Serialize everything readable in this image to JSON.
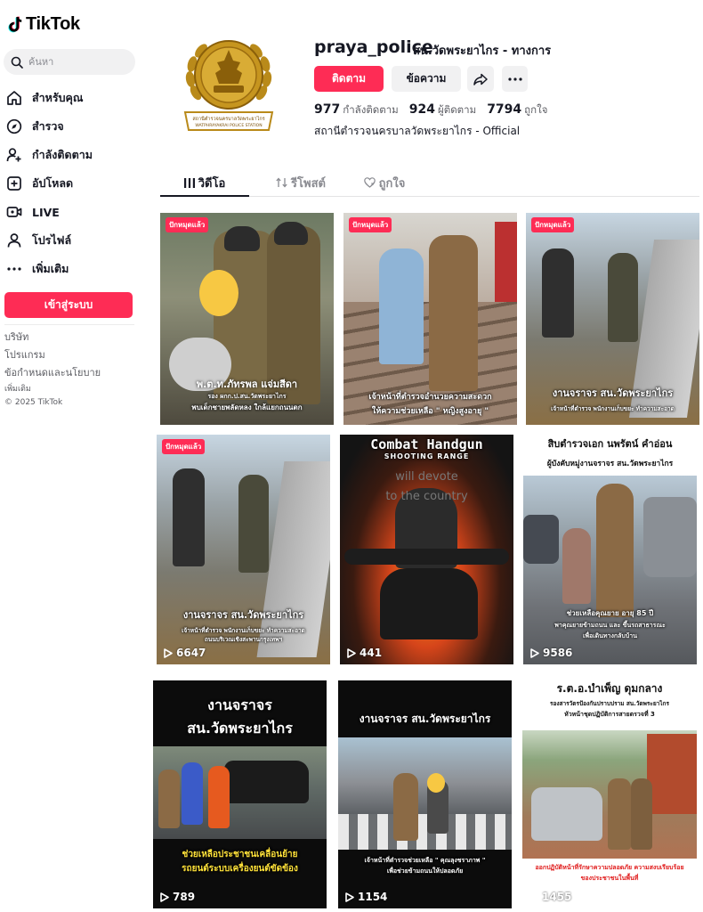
{
  "app": {
    "name": "TikTok"
  },
  "search": {
    "placeholder": "ค้นหา"
  },
  "nav": [
    {
      "label": "สำหรับคุณ",
      "icon": "home-icon"
    },
    {
      "label": "สำรวจ",
      "icon": "compass-icon"
    },
    {
      "label": "กำลังติดตาม",
      "icon": "following-icon"
    },
    {
      "label": "อัปโหลด",
      "icon": "upload-icon"
    },
    {
      "label": "LIVE",
      "icon": "live-icon"
    },
    {
      "label": "โปรไฟล์",
      "icon": "profile-icon"
    },
    {
      "label": "เพิ่มเติม",
      "icon": "more-icon"
    }
  ],
  "login": {
    "label": "เข้าสู่ระบบ"
  },
  "footer": {
    "links": [
      "บริษัท",
      "โปรแกรม",
      "ข้อกำหนดและนโยบาย"
    ],
    "more": "เพิ่มเติม",
    "copyright": "© 2025 TikTok"
  },
  "profile": {
    "username": "praya_police",
    "nickname": "สน.วัดพระยาไกร - ทางการ",
    "follow_label": "ติดตาม",
    "message_label": "ข้อความ",
    "following_count": "977",
    "following_label": "กำลังติดตาม",
    "followers_count": "924",
    "followers_label": "ผู้ติดตาม",
    "likes_count": "7794",
    "likes_label": "ถูกใจ",
    "bio": "สถานีตำรวจนครบาลวัดพระยาไกร - Official",
    "avatar_caption": "สถานีตำรวจนครบาลวัดพระยาไกร",
    "avatar_caption_en": "WATPHRAYAKRAI POLICE STATION"
  },
  "tabs": [
    {
      "label": "วิดีโอ",
      "icon": "grid-icon",
      "active": true
    },
    {
      "label": "รีโพสต์",
      "icon": "repost-icon",
      "active": false
    },
    {
      "label": "ถูกใจ",
      "icon": "heart-icon",
      "active": false
    }
  ],
  "pinned_label": "ปักหมุดแล้ว",
  "videos": [
    {
      "pinned": true,
      "views": "",
      "captions": [
        "พ.ต.ท.ภัทรพล แจ่มสีดา",
        "รอง ผกก.ป.สน.วัดพระยาไกร",
        "พบเด็กชายพลัดหลง ใกล้แยกถนนตก"
      ]
    },
    {
      "pinned": true,
      "views": "",
      "captions": [
        "เจ้าหน้าที่ตำรวจอำนวยความสะดวก",
        "ให้ความช่วยเหลือ \" หญิงสูงอายุ \""
      ]
    },
    {
      "pinned": true,
      "views": "",
      "captions": [
        "งานจราจร สน.วัดพระยาไกร",
        "เจ้าหน้าที่ตำรวจ พนักงานเก็บขยะ ทำความสะอาด"
      ]
    },
    {
      "pinned": true,
      "views": "6647",
      "captions": [
        "งานจราจร สน.วัดพระยาไกร",
        "เจ้าหน้าที่ตำรวจ พนักงานเก็บขยะ ทำความสะอาด",
        "ถนนบริเวณเชิงสะพานกรุงเทพฯ"
      ]
    },
    {
      "pinned": false,
      "views": "441",
      "captions": [
        "Combat Handgun",
        "SHOOTING RANGE",
        "will devote",
        "to the country"
      ]
    },
    {
      "pinned": false,
      "views": "9586",
      "captions": [
        "สิบตำรวจเอก นพรัตน์ คำอ่อน",
        "ผู้บังคับหมู่งานจราจร สน.วัดพระยาไกร",
        "ช่วยเหลือคุณยาย อายุ 85 ปี",
        "พาคุณยายข้ามถนน และ ขึ้นรถสาธารณะ",
        "เพื่อเดินทางกลับบ้าน"
      ]
    },
    {
      "pinned": false,
      "views": "789",
      "captions": [
        "งานจราจร",
        "สน.วัดพระยาไกร",
        "ช่วยเหลือประชาชนเคลื่อนย้าย",
        "รถยนต์ระบบเครื่องยนต์ขัดข้อง"
      ]
    },
    {
      "pinned": false,
      "views": "1154",
      "captions": [
        "งานจราจร สน.วัดพระยาไกร",
        "เจ้าหน้าที่ตำรวจช่วยเหลือ \" คุณลุงชราภาพ \"",
        "เพื่อช่วยข้ามถนนให้ปลอดภัย"
      ]
    },
    {
      "pinned": false,
      "views": "1455",
      "captions": [
        "ร.ต.อ.บำเพ็ญ ดุมกลาง",
        "รองสารวัตรป้องกันปราบปราม สน.วัดพระยาไกร",
        "หัวหน้าชุดปฏิบัติการสายตรวจที่ 3",
        "ออกปฏิบัติหน้าที่รักษาความปลอดภัย ความสงบเรียบร้อย",
        "ของประชาชนในพื้นที่"
      ]
    }
  ],
  "colors": {
    "accent": "#fe2c55",
    "text": "#161823",
    "muted": "#5c5d63",
    "bg_gray": "#f1f1f2"
  }
}
